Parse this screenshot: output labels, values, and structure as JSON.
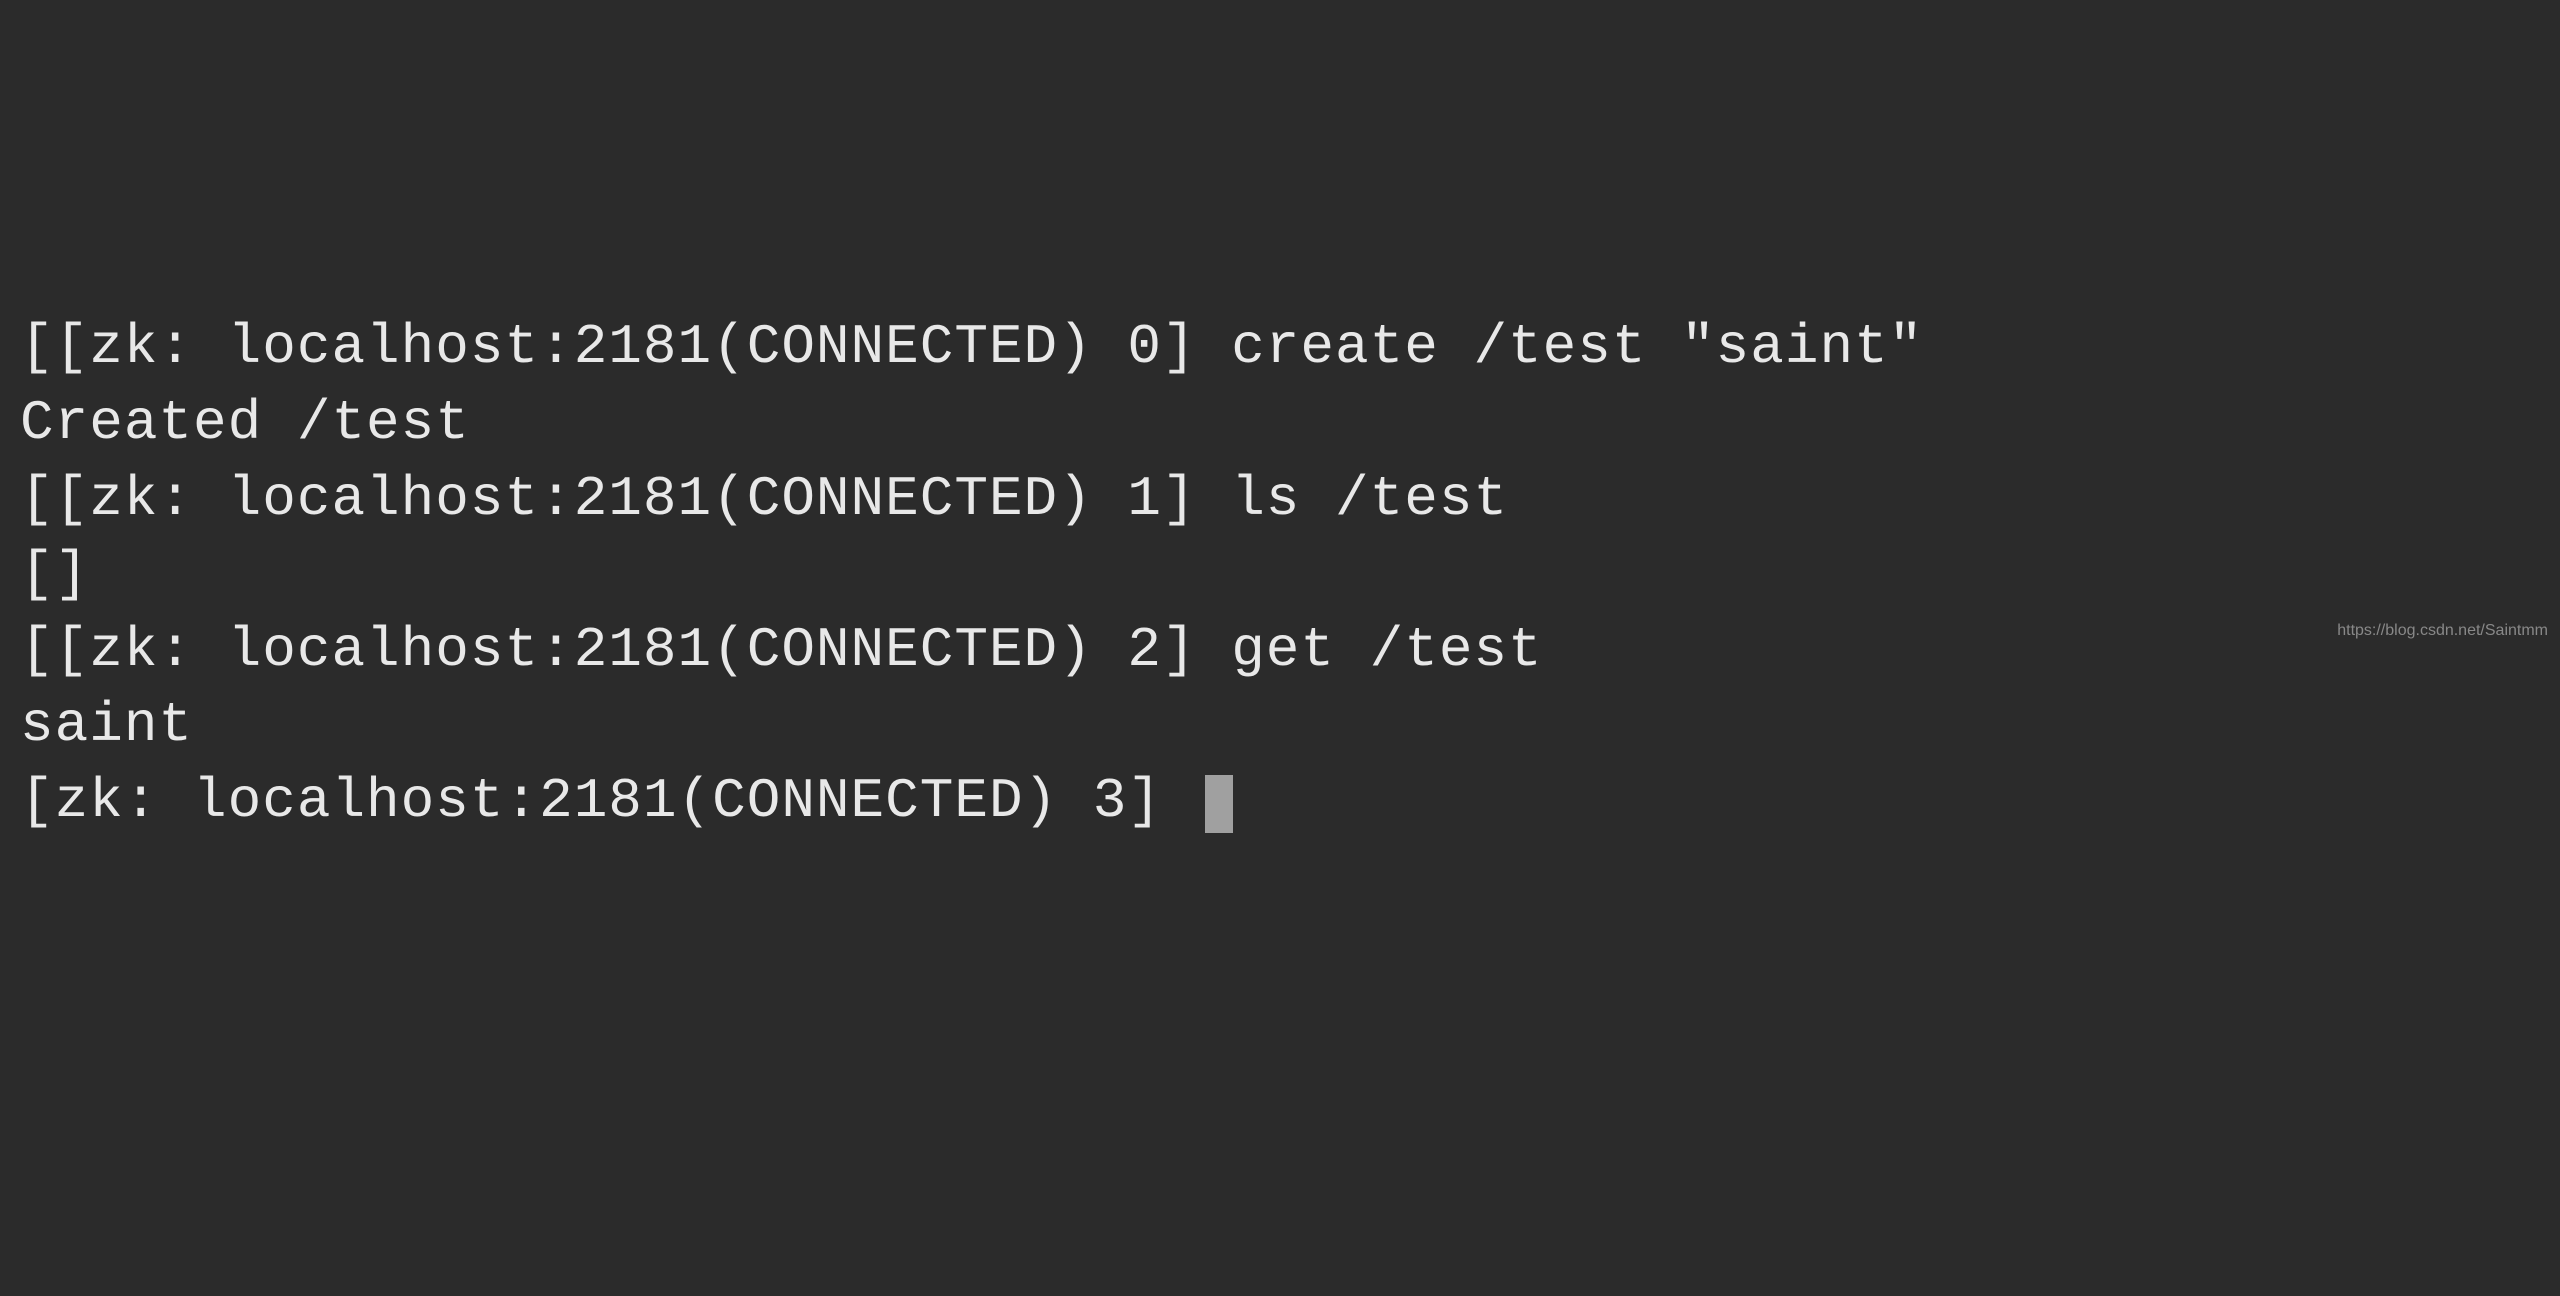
{
  "terminal": {
    "lines": [
      {
        "prompt": "[[zk: localhost:2181(CONNECTED) 0] ",
        "command": "create /test \"saint\""
      },
      {
        "output": "Created /test"
      },
      {
        "prompt": "[[zk: localhost:2181(CONNECTED) 1] ",
        "command": "ls /test"
      },
      {
        "output": "[]"
      },
      {
        "prompt": "[[zk: localhost:2181(CONNECTED) 2] ",
        "command": "get /test"
      },
      {
        "output": "saint"
      },
      {
        "prompt": "[zk: localhost:2181(CONNECTED) 3] ",
        "command": "",
        "cursor": true
      }
    ]
  },
  "watermark": "https://blog.csdn.net/Saintmm"
}
